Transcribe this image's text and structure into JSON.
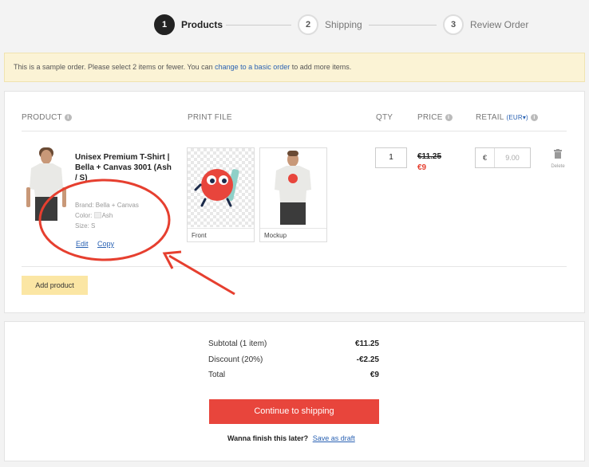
{
  "stepper": {
    "steps": [
      {
        "number": "1",
        "label": "Products",
        "active": true
      },
      {
        "number": "2",
        "label": "Shipping",
        "active": false
      },
      {
        "number": "3",
        "label": "Review Order",
        "active": false
      }
    ]
  },
  "banner": {
    "text_before": "This is a sample order. Please select 2 items or fewer. You can ",
    "link": "change to a basic order",
    "text_after": " to add more items."
  },
  "columns": {
    "product": "PRODUCT",
    "print_file": "PRINT FILE",
    "qty": "QTY",
    "price": "PRICE",
    "retail": "RETAIL",
    "currency_selector": "(EUR",
    "currency_selector_close": ")"
  },
  "product": {
    "name": "Unisex Premium T-Shirt | Bella + Canvas 3001 (Ash / S)",
    "brand": "Brand: Bella + Canvas",
    "color_label": "Color:",
    "color_value": "Ash",
    "size": "Size: S",
    "edit": "Edit",
    "copy": "Copy",
    "print_files": [
      {
        "caption": "Front"
      },
      {
        "caption": "Mockup"
      }
    ],
    "qty": "1",
    "price_old": "€11.25",
    "price_new": "€9",
    "retail_currency": "€",
    "retail_placeholder": "9.00",
    "delete": "Delete"
  },
  "add_product": "Add product",
  "summary": {
    "subtotal_label": "Subtotal (1 item)",
    "subtotal_value": "€11.25",
    "discount_label": "Discount (20%)",
    "discount_value": "-€2.25",
    "total_label": "Total",
    "total_value": "€9",
    "continue_button": "Continue to shipping",
    "later_text": "Wanna finish this later?",
    "save_draft": "Save as draft"
  },
  "colors": {
    "accent_red": "#e8453c",
    "link_blue": "#2a62b3",
    "banner_bg": "#fbf3d5",
    "add_button_bg": "#fbe6a4"
  }
}
